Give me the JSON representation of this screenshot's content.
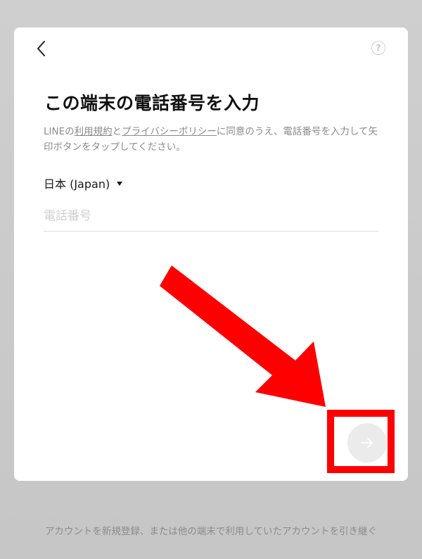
{
  "screen": {
    "title": "この端末の電話番号を入力",
    "description": {
      "prefix": "LINEの",
      "terms_link": "利用規約",
      "middle": "と",
      "privacy_link": "プライバシーポリシー",
      "suffix": "に同意のうえ、電話番号を入力して矢印ボタンをタップしてください。"
    },
    "country_select": {
      "value": "日本 (Japan)"
    },
    "phone_field": {
      "placeholder": "電話番号",
      "value": ""
    },
    "help_label": "?",
    "footer_link": "アカウントを新規登録、または他の端末で利用していたアカウントを引き継ぐ"
  },
  "icons": {
    "back": "chevron-left-icon",
    "help": "question-circle-icon",
    "next": "arrow-right-icon",
    "country_caret": "caret-down-icon"
  },
  "colors": {
    "annotation_red": "#ff0000",
    "next_button_disabled": "#ebebeb",
    "text_primary": "#111111",
    "text_secondary": "#8a8a8a"
  }
}
